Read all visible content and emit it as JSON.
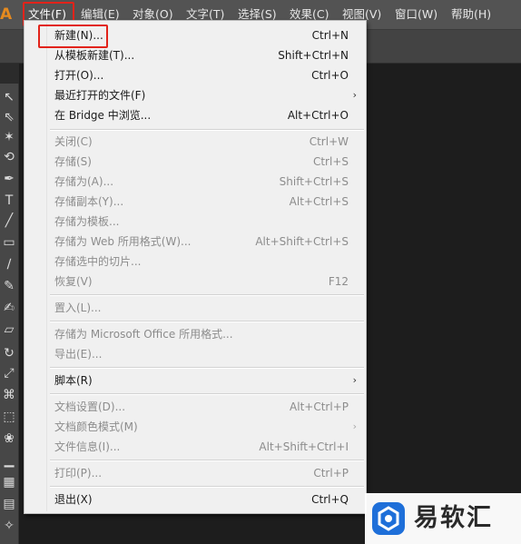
{
  "app": {
    "logo_text": "Ai"
  },
  "menubar": {
    "items": [
      {
        "label": "文件(F)",
        "active": true
      },
      {
        "label": "编辑(E)"
      },
      {
        "label": "对象(O)"
      },
      {
        "label": "文字(T)"
      },
      {
        "label": "选择(S)"
      },
      {
        "label": "效果(C)"
      },
      {
        "label": "视图(V)"
      },
      {
        "label": "窗口(W)"
      },
      {
        "label": "帮助(H)"
      }
    ]
  },
  "file_menu": {
    "items": [
      {
        "label": "新建(N)...",
        "shortcut": "Ctrl+N",
        "enabled": true,
        "highlighted": true
      },
      {
        "label": "从模板新建(T)...",
        "shortcut": "Shift+Ctrl+N",
        "enabled": true
      },
      {
        "label": "打开(O)...",
        "shortcut": "Ctrl+O",
        "enabled": true
      },
      {
        "label": "最近打开的文件(F)",
        "shortcut": "",
        "enabled": true,
        "submenu": true
      },
      {
        "label": "在 Bridge 中浏览...",
        "shortcut": "Alt+Ctrl+O",
        "enabled": true
      },
      {
        "label": "关闭(C)",
        "shortcut": "Ctrl+W",
        "enabled": false
      },
      {
        "label": "存储(S)",
        "shortcut": "Ctrl+S",
        "enabled": false
      },
      {
        "label": "存储为(A)...",
        "shortcut": "Shift+Ctrl+S",
        "enabled": false
      },
      {
        "label": "存储副本(Y)...",
        "shortcut": "Alt+Ctrl+S",
        "enabled": false
      },
      {
        "label": "存储为模板...",
        "shortcut": "",
        "enabled": false
      },
      {
        "label": "存储为 Web 所用格式(W)...",
        "shortcut": "Alt+Shift+Ctrl+S",
        "enabled": false
      },
      {
        "label": "存储选中的切片...",
        "shortcut": "",
        "enabled": false
      },
      {
        "label": "恢复(V)",
        "shortcut": "F12",
        "enabled": false
      },
      {
        "label": "置入(L)...",
        "shortcut": "",
        "enabled": false
      },
      {
        "label": "存储为 Microsoft Office 所用格式...",
        "shortcut": "",
        "enabled": false
      },
      {
        "label": "导出(E)...",
        "shortcut": "",
        "enabled": false
      },
      {
        "label": "脚本(R)",
        "shortcut": "",
        "enabled": true,
        "submenu": true
      },
      {
        "label": "文档设置(D)...",
        "shortcut": "Alt+Ctrl+P",
        "enabled": false
      },
      {
        "label": "文档颜色模式(M)",
        "shortcut": "",
        "enabled": false,
        "submenu": true
      },
      {
        "label": "文件信息(I)...",
        "shortcut": "Alt+Shift+Ctrl+I",
        "enabled": false
      },
      {
        "label": "打印(P)...",
        "shortcut": "Ctrl+P",
        "enabled": false
      },
      {
        "label": "退出(X)",
        "shortcut": "Ctrl+Q",
        "enabled": true
      }
    ]
  },
  "tools": {
    "icons": [
      "selection-arrow",
      "direct-selection",
      "magic-wand",
      "lasso",
      "pen",
      "type",
      "line",
      "rectangle",
      "paintbrush",
      "pencil",
      "blob-brush",
      "eraser",
      "rotate",
      "scale",
      "warp",
      "free-transform",
      "symbol-sprayer",
      "graph",
      "mesh",
      "gradient",
      "eyedropper"
    ]
  },
  "watermark": {
    "text": "易软汇",
    "color": "#1e6fd9"
  },
  "colors": {
    "highlight_box": "#e2231a",
    "menubar_bg": "#535353",
    "menu_bg": "#f0f0f0"
  }
}
